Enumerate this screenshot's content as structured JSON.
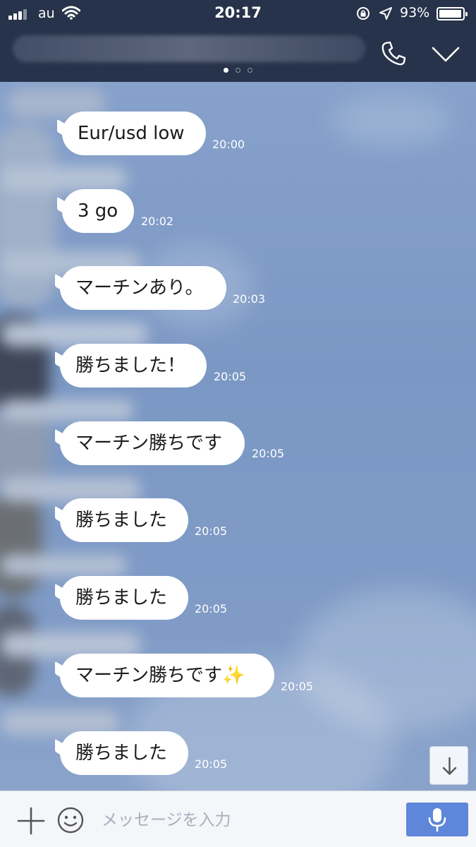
{
  "status_bar": {
    "carrier": "au",
    "time": "20:17",
    "battery_percent": "93%"
  },
  "header": {
    "page_indicator": {
      "count": 3,
      "active": 0
    }
  },
  "messages": [
    {
      "text": "Eur/usd low",
      "time": "20:00"
    },
    {
      "text": "3 go",
      "time": "20:02"
    },
    {
      "text": "マーチンあり。",
      "time": "20:03"
    },
    {
      "text": "勝ちました！",
      "time": "20:05"
    },
    {
      "text": "マーチン勝ちです",
      "time": "20:05"
    },
    {
      "text": "勝ちました",
      "time": "20:05"
    },
    {
      "text": "勝ちました",
      "time": "20:05"
    },
    {
      "text": "マーチン勝ちです✨",
      "time": "20:05"
    },
    {
      "text": "勝ちました",
      "time": "20:05"
    }
  ],
  "input_bar": {
    "placeholder": "メッセージを入力"
  },
  "icons": {
    "call": "phone-icon",
    "collapse": "chevron-down-icon",
    "scroll_down": "arrow-down-icon",
    "add": "plus-icon",
    "emoji": "emoji-icon",
    "voice": "microphone-icon"
  },
  "colors": {
    "header": "#27334a",
    "chat_background": "#7f9cc6",
    "bubble": "#ffffff",
    "mic_button": "#5e86d9"
  }
}
